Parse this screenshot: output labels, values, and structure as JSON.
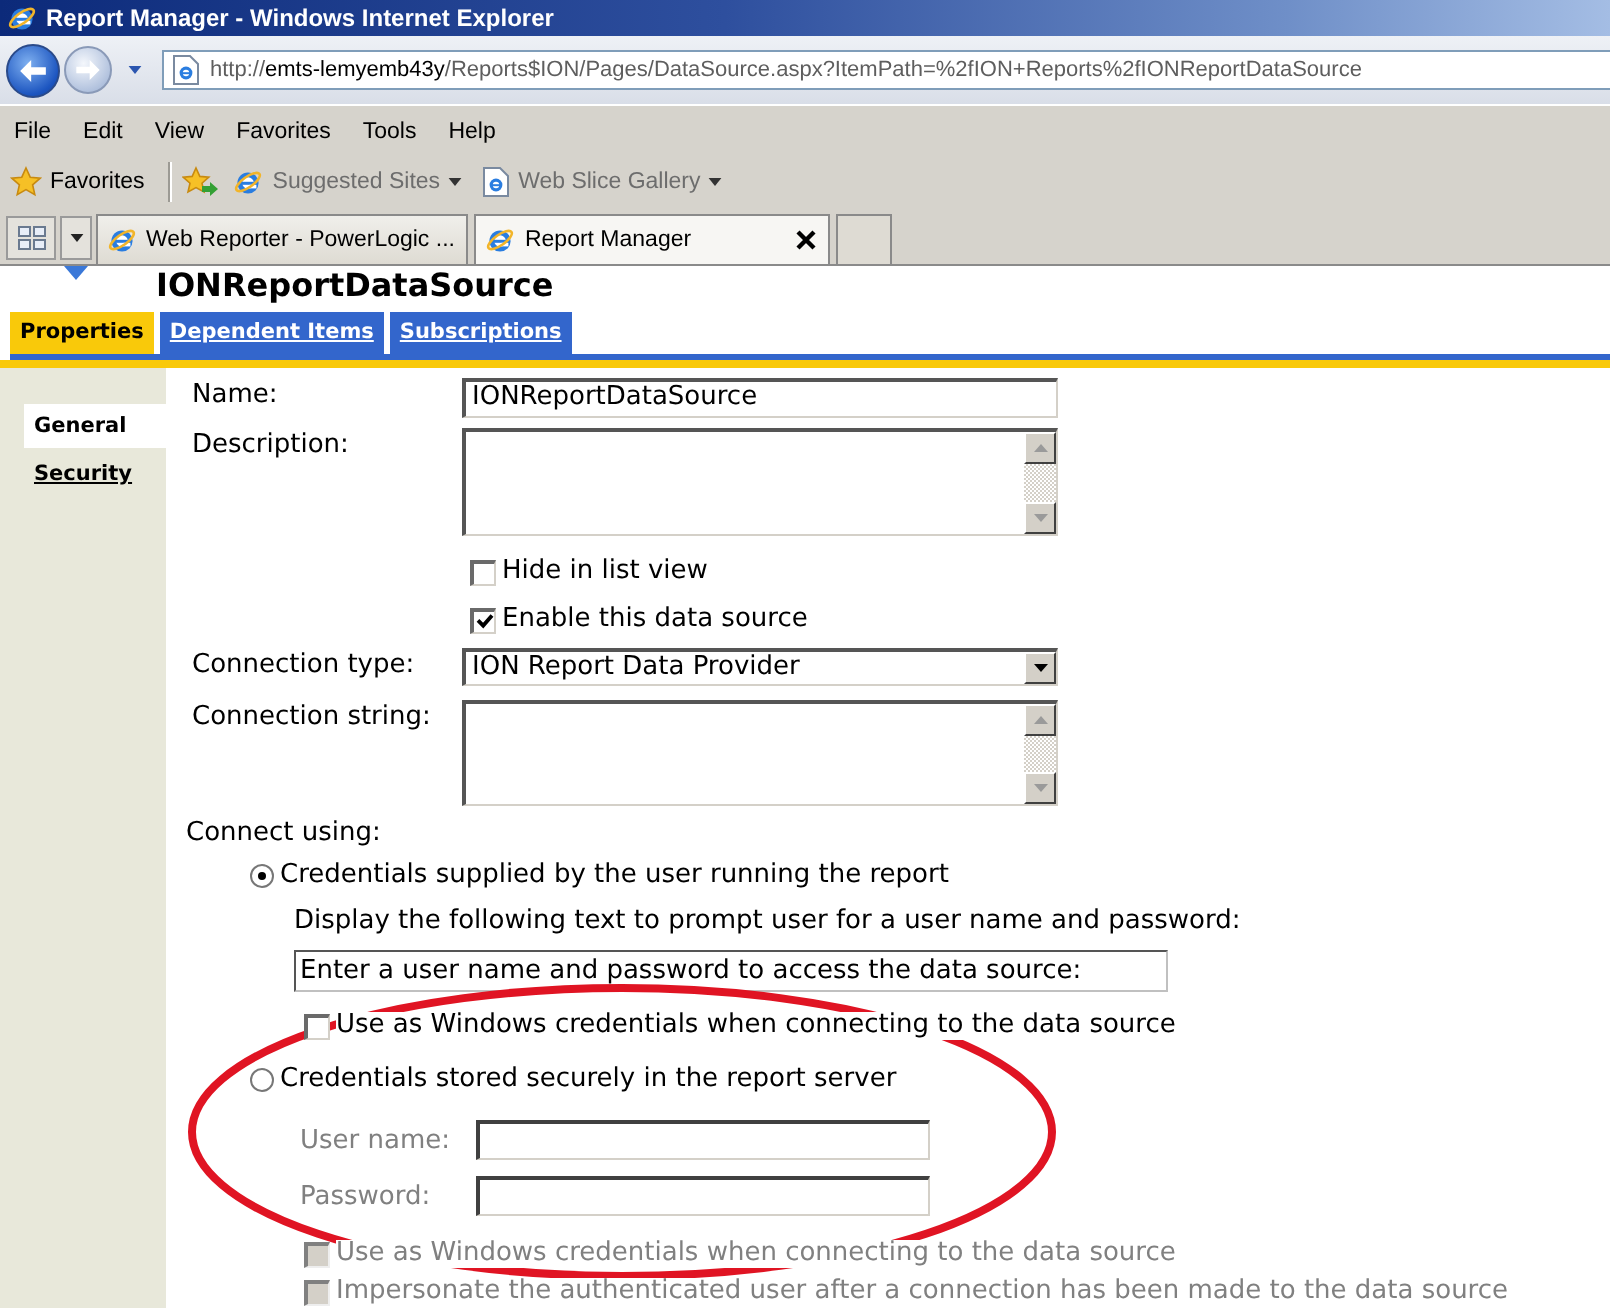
{
  "window": {
    "title": "Report Manager - Windows Internet Explorer"
  },
  "address_bar": {
    "url": {
      "scheme": "http://",
      "host": "emts-lemyemb43y",
      "path": "/Reports$ION/Pages/DataSource.aspx?ItemPath=%2fION+Reports%2fIONReportDataSource"
    }
  },
  "menu_bar": [
    "File",
    "Edit",
    "View",
    "Favorites",
    "Tools",
    "Help"
  ],
  "favorites_bar": {
    "favorites": "Favorites",
    "links": [
      {
        "label": "Suggested Sites"
      },
      {
        "label": "Web Slice Gallery"
      }
    ]
  },
  "browser_tabs": [
    {
      "label": "Web Reporter - PowerLogic ...",
      "selected": false
    },
    {
      "label": "Report Manager",
      "selected": true
    }
  ],
  "page": {
    "heading": "IONReportDataSource",
    "tabs": [
      {
        "label": "Properties",
        "selected": true
      },
      {
        "label": "Dependent Items",
        "selected": false
      },
      {
        "label": "Subscriptions",
        "selected": false
      }
    ],
    "side_nav": [
      {
        "label": "General",
        "selected": true
      },
      {
        "label": "Security",
        "selected": false
      }
    ],
    "form": [
      {
        "kind": "text",
        "label": "Name:",
        "value": "IONReportDataSource"
      },
      {
        "kind": "textarea",
        "label": "Description:"
      },
      {
        "kind": "checkbox",
        "label": "Hide in list view",
        "checked": false
      },
      {
        "kind": "checkbox",
        "label": "Enable this data source",
        "checked": true
      },
      {
        "kind": "select",
        "label": "Connection type:",
        "value": "ION Report Data Provider"
      },
      {
        "kind": "textarea",
        "label": "Connection string:"
      }
    ],
    "connect_using": {
      "label": "Connect using:",
      "options": [
        {
          "label": "Credentials supplied by the user running the report",
          "selected": true,
          "items": [
            {
              "kind": "note",
              "text": "Display the following text to prompt user for a user name and password:"
            },
            {
              "kind": "input",
              "value": "Enter a user name and password to access the data source:"
            },
            {
              "kind": "checkbox",
              "label": "Use as Windows credentials when connecting to the data source",
              "checked": false,
              "disabled": false
            }
          ]
        },
        {
          "label": "Credentials stored securely in the report server",
          "selected": false,
          "items": [
            {
              "kind": "field",
              "label": "User name:",
              "disabled": true
            },
            {
              "kind": "field",
              "label": "Password:",
              "disabled": true
            },
            {
              "kind": "checkbox",
              "label": "Use as Windows credentials when connecting to the data source",
              "checked": false,
              "disabled": true
            },
            {
              "kind": "checkbox",
              "label": "Impersonate the authenticated user after a connection has been made to the data source",
              "checked": false,
              "disabled": true
            }
          ]
        }
      ]
    }
  }
}
